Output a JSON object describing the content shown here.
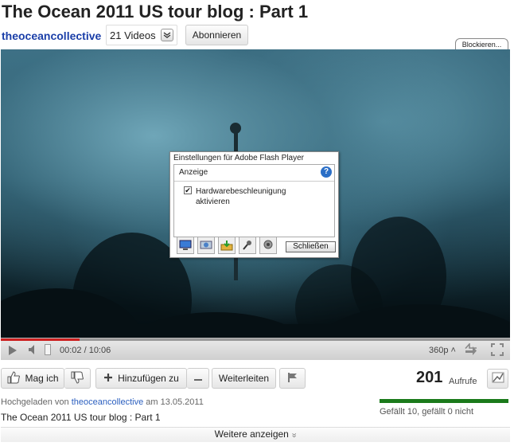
{
  "page": {
    "title": "The Ocean 2011 US tour blog : Part 1"
  },
  "channel": {
    "name": "theoceancollective",
    "videos_label": "21 Videos",
    "subscribe_label": "Abonnieren",
    "block_label": "Blockieren..."
  },
  "flash_dialog": {
    "title": "Einstellungen für Adobe Flash Player",
    "section": "Anzeige",
    "help": "?",
    "checkbox_checked": true,
    "checkbox_mark": "✔",
    "checkbox_label": "Hardwarebeschleunigung aktivieren",
    "close_label": "Schließen",
    "tabs": [
      "display-icon",
      "privacy-icon",
      "storage-icon",
      "microphone-icon",
      "camera-icon"
    ]
  },
  "player": {
    "time": "00:02 / 10:06",
    "quality": "360p",
    "quality_arrow": "˄",
    "progress": 0.155
  },
  "actions": {
    "like_label": "Mag ich",
    "add_label": "Hinzufügen zu",
    "share_label": "Weiterleiten"
  },
  "stats": {
    "views": "201",
    "views_label": "Aufrufe",
    "likes_text": "Gefällt 10, gefällt 0 nicht",
    "like_ratio": 1.0
  },
  "info": {
    "uploaded_prefix": "Hochgeladen von",
    "uploader": "theoceancollective",
    "uploaded_suffix": "am 13.05.2011",
    "description": "The Ocean 2011 US tour blog : Part 1",
    "more_label": "Weitere anzeigen",
    "more_arrow": "»"
  },
  "colors": {
    "link": "#1a3ea8",
    "progress": "#cc1f1f",
    "ratio_bar": "#1b7a1b",
    "help_icon": "#2b6fc7"
  }
}
